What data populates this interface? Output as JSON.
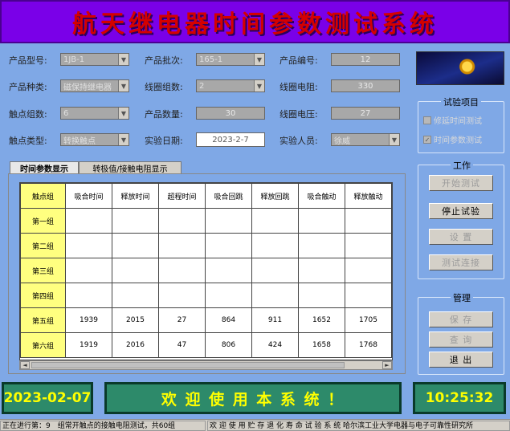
{
  "title": "航天继电器时间参数测试系统",
  "form": {
    "product_model": {
      "label": "产品型号:",
      "value": "1JB-1"
    },
    "product_batch": {
      "label": "产品批次:",
      "value": "165-1"
    },
    "product_number": {
      "label": "产品编号:",
      "value": "12"
    },
    "product_type": {
      "label": "产品种类:",
      "value": "磁保持继电器"
    },
    "coil_groups": {
      "label": "线圈组数:",
      "value": "2"
    },
    "coil_resistance": {
      "label": "线圈电阻:",
      "value": "330"
    },
    "contact_groups": {
      "label": "触点组数:",
      "value": "6"
    },
    "product_quantity": {
      "label": "产品数量:",
      "value": "30"
    },
    "coil_voltage": {
      "label": "线圈电压:",
      "value": "27"
    },
    "contact_type": {
      "label": "触点类型:",
      "value": "转换触点"
    },
    "test_date": {
      "label": "实验日期:",
      "value": "2023-2-7"
    },
    "tester": {
      "label": "实验人员:",
      "value": "徐威"
    }
  },
  "test_items": {
    "title": "试验项目",
    "items": [
      {
        "label": "修延时间测试",
        "checked": false
      },
      {
        "label": "时间参数测试",
        "checked": true
      }
    ]
  },
  "work": {
    "title": "工作",
    "buttons": {
      "start": "开始测试",
      "stop": "停止试验",
      "settings": "设 置",
      "connect": "测试连接"
    }
  },
  "manage": {
    "title": "管理",
    "buttons": {
      "save": "保 存",
      "query": "查 询",
      "exit": "退 出"
    }
  },
  "tabs": [
    "时间参数显示",
    "转极值/接触电阻显示"
  ],
  "table": {
    "corner": "触点组",
    "headers": [
      "吸合时间",
      "释放时间",
      "超程时间",
      "吸合回跳",
      "释放回跳",
      "吸合触动",
      "释放触动"
    ],
    "rows": [
      {
        "name": "第一组",
        "cells": [
          "",
          "",
          "",
          "",
          "",
          "",
          ""
        ]
      },
      {
        "name": "第二组",
        "cells": [
          "",
          "",
          "",
          "",
          "",
          "",
          ""
        ]
      },
      {
        "name": "第三组",
        "cells": [
          "",
          "",
          "",
          "",
          "",
          "",
          ""
        ]
      },
      {
        "name": "第四组",
        "cells": [
          "",
          "",
          "",
          "",
          "",
          "",
          ""
        ]
      },
      {
        "name": "第五组",
        "cells": [
          "1939",
          "2015",
          "27",
          "864",
          "911",
          "1652",
          "1705"
        ]
      },
      {
        "name": "第六组",
        "cells": [
          "1919",
          "2016",
          "47",
          "806",
          "424",
          "1658",
          "1768"
        ]
      }
    ]
  },
  "date_display": "2023-02-07",
  "welcome": "欢 迎 使 用 本 系 统 ！",
  "time_display": "10:25:32",
  "status_bar": {
    "progress": "正在进行第：9　组常开触点的接触电阻测试，共60组",
    "credit": "欢 迎 使 用 贮 存 退 化 寿 命 试 验 系 统 哈尔滨工业大学电器与电子可靠性研究所"
  },
  "colors": {
    "background": "#7fa8e6",
    "title_bg": "#7a00e8",
    "title_text": "#d40000",
    "led_bg": "#2d8a6a",
    "led_text": "#ffff00",
    "row_header": "#ffff80"
  }
}
